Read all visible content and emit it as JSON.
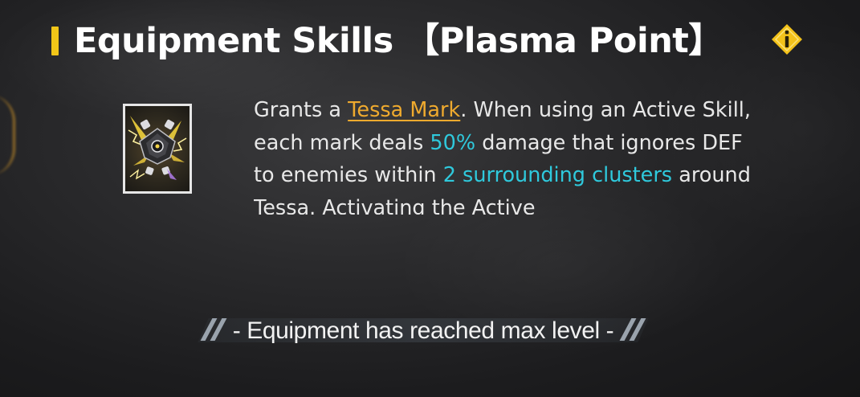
{
  "header": {
    "title": "Equipment Skills 【Plasma Point】",
    "info_icon": "info-diamond-icon",
    "accent_color": "#f2c618"
  },
  "skill": {
    "icon": "plasma-point-drone-icon",
    "description": {
      "part1": "Grants a ",
      "link": "Tessa Mark",
      "part2": ". When using an Active Skill, each mark deals ",
      "value1": "50%",
      "part3": " damage that ignores DEF to enemies within ",
      "value2": "2 surrounding clusters",
      "part4": " around Tessa. Activating the Active"
    },
    "colors": {
      "link": "#efaa2e",
      "highlight": "#2fc9dc"
    }
  },
  "footer": {
    "max_level_text": "- Equipment has reached max level -"
  }
}
